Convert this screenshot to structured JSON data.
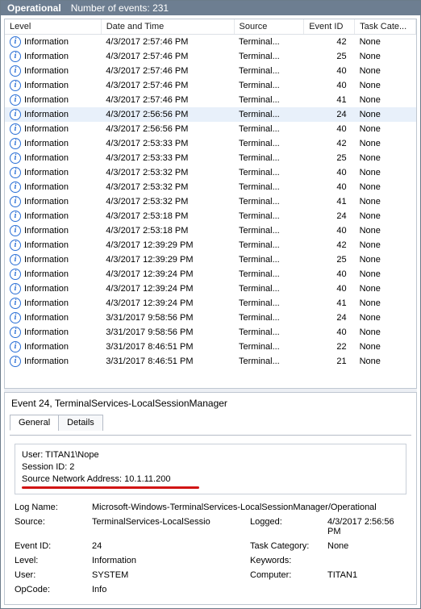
{
  "titlebar": {
    "status": "Operational",
    "count_label": "Number of events: 231"
  },
  "columns": {
    "level": "Level",
    "date": "Date and Time",
    "source": "Source",
    "event_id": "Event ID",
    "task_cat": "Task Cate..."
  },
  "row_level_label": "Information",
  "rows": [
    {
      "date": "4/3/2017 2:57:46 PM",
      "source": "Terminal...",
      "eid": "42",
      "tcat": "None",
      "sel": false
    },
    {
      "date": "4/3/2017 2:57:46 PM",
      "source": "Terminal...",
      "eid": "25",
      "tcat": "None",
      "sel": false
    },
    {
      "date": "4/3/2017 2:57:46 PM",
      "source": "Terminal...",
      "eid": "40",
      "tcat": "None",
      "sel": false
    },
    {
      "date": "4/3/2017 2:57:46 PM",
      "source": "Terminal...",
      "eid": "40",
      "tcat": "None",
      "sel": false
    },
    {
      "date": "4/3/2017 2:57:46 PM",
      "source": "Terminal...",
      "eid": "41",
      "tcat": "None",
      "sel": false
    },
    {
      "date": "4/3/2017 2:56:56 PM",
      "source": "Terminal...",
      "eid": "24",
      "tcat": "None",
      "sel": true
    },
    {
      "date": "4/3/2017 2:56:56 PM",
      "source": "Terminal...",
      "eid": "40",
      "tcat": "None",
      "sel": false
    },
    {
      "date": "4/3/2017 2:53:33 PM",
      "source": "Terminal...",
      "eid": "42",
      "tcat": "None",
      "sel": false
    },
    {
      "date": "4/3/2017 2:53:33 PM",
      "source": "Terminal...",
      "eid": "25",
      "tcat": "None",
      "sel": false
    },
    {
      "date": "4/3/2017 2:53:32 PM",
      "source": "Terminal...",
      "eid": "40",
      "tcat": "None",
      "sel": false
    },
    {
      "date": "4/3/2017 2:53:32 PM",
      "source": "Terminal...",
      "eid": "40",
      "tcat": "None",
      "sel": false
    },
    {
      "date": "4/3/2017 2:53:32 PM",
      "source": "Terminal...",
      "eid": "41",
      "tcat": "None",
      "sel": false
    },
    {
      "date": "4/3/2017 2:53:18 PM",
      "source": "Terminal...",
      "eid": "24",
      "tcat": "None",
      "sel": false
    },
    {
      "date": "4/3/2017 2:53:18 PM",
      "source": "Terminal...",
      "eid": "40",
      "tcat": "None",
      "sel": false
    },
    {
      "date": "4/3/2017 12:39:29 PM",
      "source": "Terminal...",
      "eid": "42",
      "tcat": "None",
      "sel": false
    },
    {
      "date": "4/3/2017 12:39:29 PM",
      "source": "Terminal...",
      "eid": "25",
      "tcat": "None",
      "sel": false
    },
    {
      "date": "4/3/2017 12:39:24 PM",
      "source": "Terminal...",
      "eid": "40",
      "tcat": "None",
      "sel": false
    },
    {
      "date": "4/3/2017 12:39:24 PM",
      "source": "Terminal...",
      "eid": "40",
      "tcat": "None",
      "sel": false
    },
    {
      "date": "4/3/2017 12:39:24 PM",
      "source": "Terminal...",
      "eid": "41",
      "tcat": "None",
      "sel": false
    },
    {
      "date": "3/31/2017 9:58:56 PM",
      "source": "Terminal...",
      "eid": "24",
      "tcat": "None",
      "sel": false
    },
    {
      "date": "3/31/2017 9:58:56 PM",
      "source": "Terminal...",
      "eid": "40",
      "tcat": "None",
      "sel": false
    },
    {
      "date": "3/31/2017 8:46:51 PM",
      "source": "Terminal...",
      "eid": "22",
      "tcat": "None",
      "sel": false
    },
    {
      "date": "3/31/2017 8:46:51 PM",
      "source": "Terminal...",
      "eid": "21",
      "tcat": "None",
      "sel": false
    }
  ],
  "detail": {
    "title": "Event 24, TerminalServices-LocalSessionManager",
    "tabs": {
      "general": "General",
      "details": "Details"
    },
    "msg": {
      "line1": "User: TITAN1\\Nope",
      "line2": "Session ID: 2",
      "line3": "Source Network Address: 10.1.11.200"
    },
    "meta": {
      "logname_k": "Log Name:",
      "logname_v": "Microsoft-Windows-TerminalServices-LocalSessionManager/Operational",
      "source_k": "Source:",
      "source_v": "TerminalServices-LocalSessio",
      "logged_k": "Logged:",
      "logged_v": "4/3/2017 2:56:56 PM",
      "eventid_k": "Event ID:",
      "eventid_v": "24",
      "taskcat_k": "Task Category:",
      "taskcat_v": "None",
      "level_k": "Level:",
      "level_v": "Information",
      "keywords_k": "Keywords:",
      "keywords_v": "",
      "user_k": "User:",
      "user_v": "SYSTEM",
      "computer_k": "Computer:",
      "computer_v": "TITAN1",
      "opcode_k": "OpCode:",
      "opcode_v": "Info"
    }
  }
}
